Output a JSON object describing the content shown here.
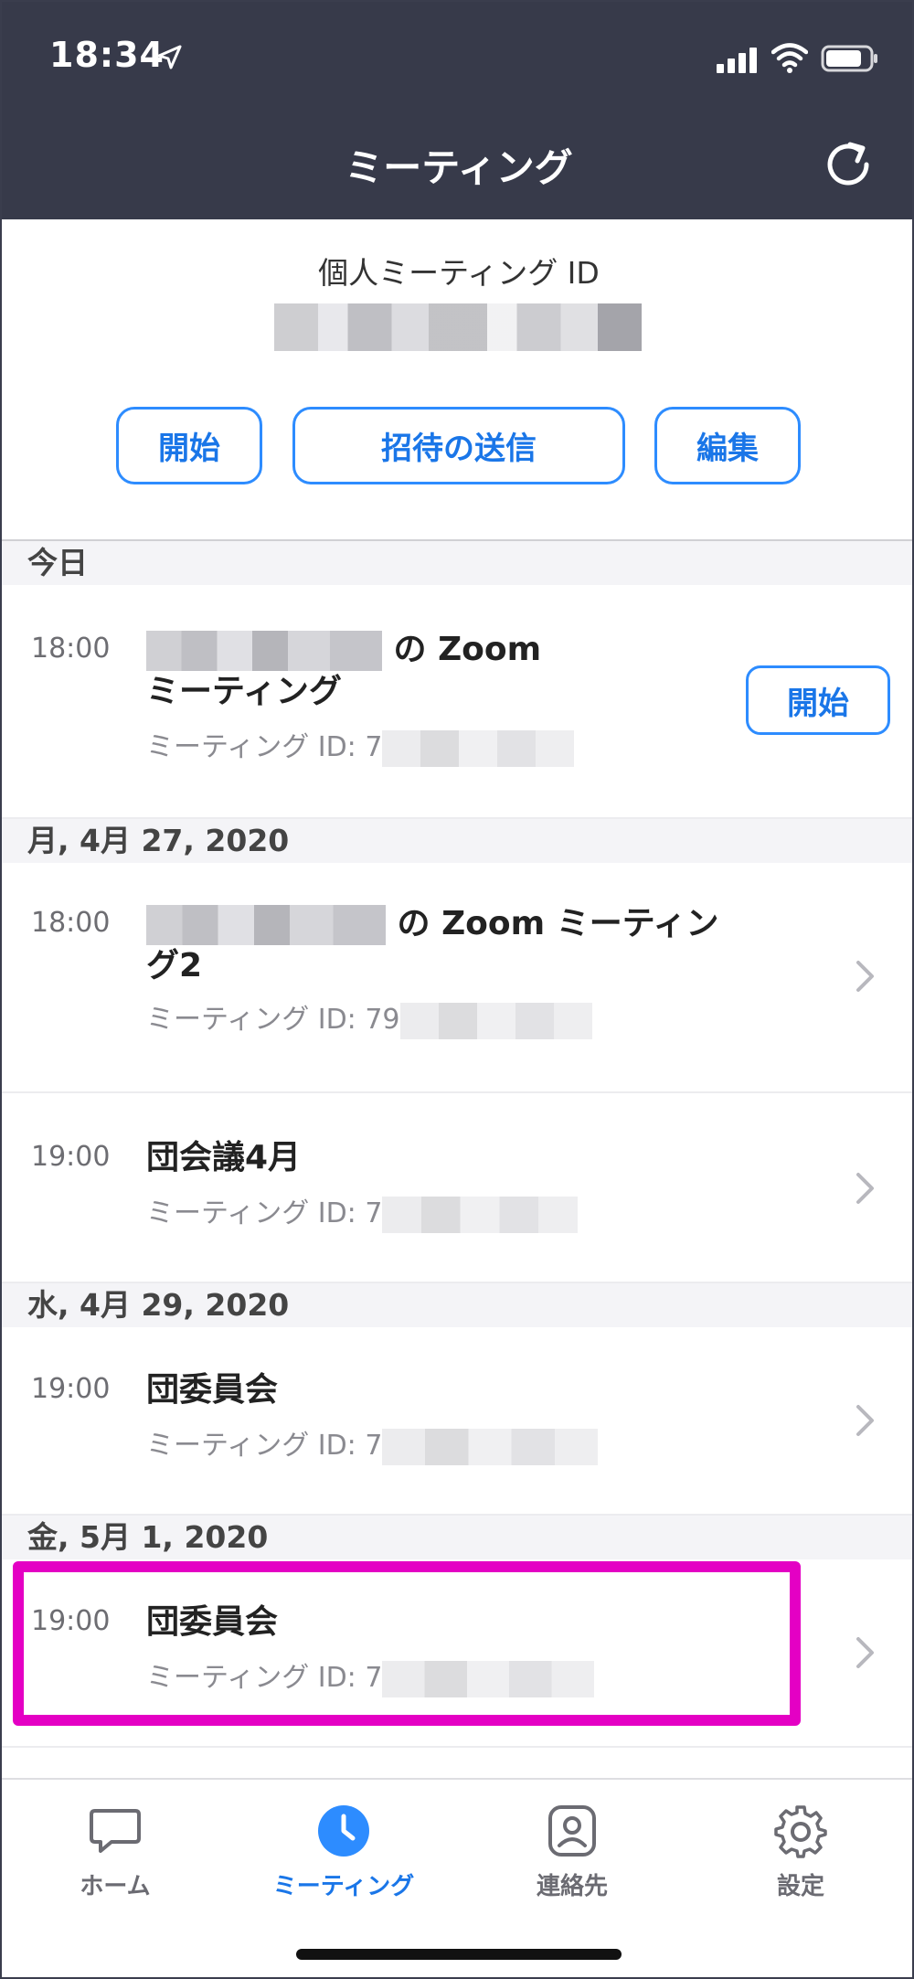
{
  "status_bar": {
    "time": "18:34"
  },
  "header": {
    "title": "ミーティング"
  },
  "personal_meeting": {
    "label": "個人ミーティング ID",
    "buttons": {
      "start": "開始",
      "invite": "招待の送信",
      "edit": "編集"
    }
  },
  "sections": [
    {
      "date": "今日",
      "meetings": [
        {
          "time": "18:00",
          "title_suffix": "の Zoom",
          "title_line2": "ミーティング",
          "id_prefix": "ミーティング ID: 7",
          "action": "開始"
        }
      ]
    },
    {
      "date": "月, 4月 27, 2020",
      "meetings": [
        {
          "time": "18:00",
          "title_suffix": "の Zoom ミーティン",
          "title_line2": "グ2",
          "id_prefix": "ミーティング ID: 79"
        },
        {
          "time": "19:00",
          "title": "団会議4月",
          "id_prefix": "ミーティング ID: 7"
        }
      ]
    },
    {
      "date": "水, 4月 29, 2020",
      "meetings": [
        {
          "time": "19:00",
          "title": "団委員会",
          "id_prefix": "ミーティング ID: 7"
        }
      ]
    },
    {
      "date": "金, 5月 1, 2020",
      "meetings": [
        {
          "time": "19:00",
          "title": "団委員会",
          "id_prefix": "ミーティング ID: 7"
        }
      ]
    }
  ],
  "tabs": [
    {
      "label": "ホーム",
      "icon": "chat-bubble-icon",
      "active": false
    },
    {
      "label": "ミーティング",
      "icon": "clock-icon",
      "active": true
    },
    {
      "label": "連絡先",
      "icon": "contact-icon",
      "active": false
    },
    {
      "label": "設定",
      "icon": "gear-icon",
      "active": false
    }
  ],
  "colors": {
    "header_bg": "#373a4a",
    "accent": "#2d8cff",
    "highlight": "#e400c4"
  }
}
